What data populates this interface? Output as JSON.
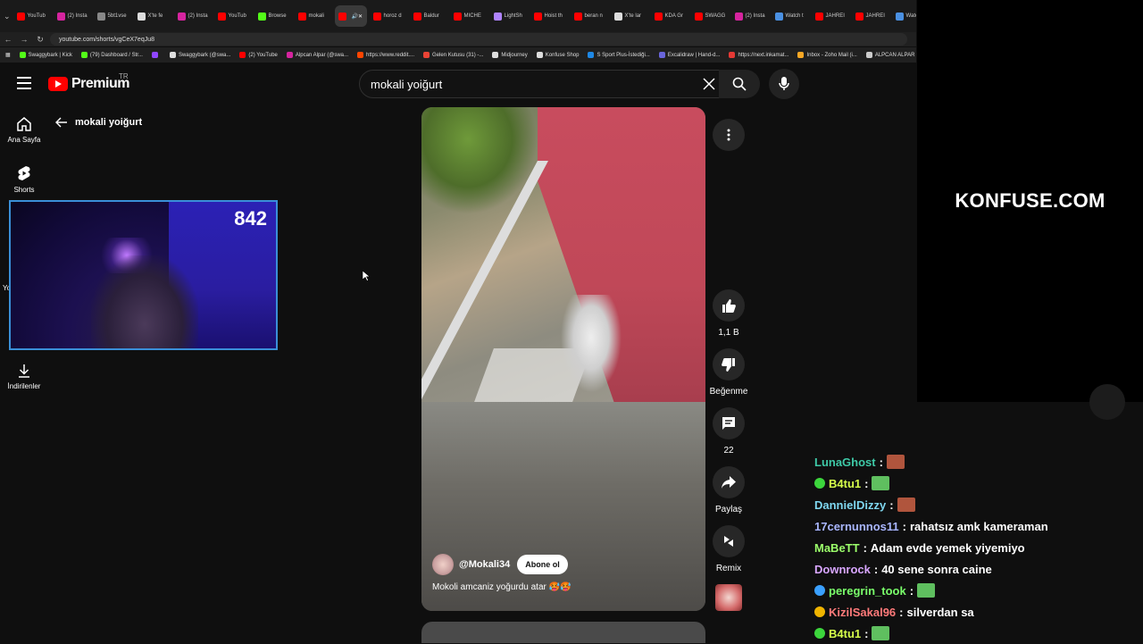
{
  "browser": {
    "tabs": [
      {
        "label": "YouTub",
        "color": "#ff0000"
      },
      {
        "label": "(2) Insta",
        "color": "#d6249f"
      },
      {
        "label": "5bt1vse",
        "color": "#888888"
      },
      {
        "label": "X'te fe",
        "color": "#dddddd"
      },
      {
        "label": "(2) Insta",
        "color": "#d6249f"
      },
      {
        "label": "YouTub",
        "color": "#ff0000"
      },
      {
        "label": "Browse",
        "color": "#53fc18"
      },
      {
        "label": "mokali",
        "color": "#ff0000"
      },
      {
        "label": "",
        "color": "#ff0000",
        "active": true
      },
      {
        "label": "horoz d",
        "color": "#ff0000"
      },
      {
        "label": "Baldur",
        "color": "#ff0000"
      },
      {
        "label": "MICHE",
        "color": "#ff0000"
      },
      {
        "label": "LightSh",
        "color": "#b084ff"
      },
      {
        "label": "Hoist th",
        "color": "#ff0000"
      },
      {
        "label": "beran n",
        "color": "#ff0000"
      },
      {
        "label": "X'te lar",
        "color": "#dddddd"
      },
      {
        "label": "KDA Gr",
        "color": "#ff0000"
      },
      {
        "label": "SWAGG",
        "color": "#ff0000"
      },
      {
        "label": "(2) Insta",
        "color": "#d6249f"
      },
      {
        "label": "Watch t",
        "color": "#4a90e2"
      },
      {
        "label": "JAHREI",
        "color": "#ff0000"
      },
      {
        "label": "JAHREI",
        "color": "#ff0000"
      },
      {
        "label": "Watch",
        "color": "#4a90e2"
      }
    ],
    "url": "youtube.com/shorts/vgCeX7eqJu8",
    "bookmarks": [
      {
        "label": "Swaggybark | Kick",
        "color": "#53fc18"
      },
      {
        "label": "(79) Dashboard / Str...",
        "color": "#53fc18"
      },
      {
        "label": "",
        "color": "#9146ff"
      },
      {
        "label": "Swaggybark (@swa...",
        "color": "#dddddd"
      },
      {
        "label": "(2) YouTube",
        "color": "#ff0000"
      },
      {
        "label": "Alpcan Alpar (@swa...",
        "color": "#d6249f"
      },
      {
        "label": "https://www.reddit....",
        "color": "#ff4500"
      },
      {
        "label": "Gelen Kutusu (31) -...",
        "color": "#ea4335"
      },
      {
        "label": "Midjourney",
        "color": "#dddddd"
      },
      {
        "label": "Konfuse Shop",
        "color": "#dddddd"
      },
      {
        "label": "S Sport Plus-İstediği...",
        "color": "#1e88e5"
      },
      {
        "label": "Excalidraw | Hand-d...",
        "color": "#6965db"
      },
      {
        "label": "https://next.inkamat...",
        "color": "#e53935"
      },
      {
        "label": "Inbox - Zoho Mail (i...",
        "color": "#f9a825"
      },
      {
        "label": "ALPCAN ALPAR DEV...",
        "color": "#cccccc"
      }
    ]
  },
  "header": {
    "logo": "Premium",
    "region": "TR",
    "search_value": "mokali yoiğurt"
  },
  "sidebar": {
    "items": [
      {
        "label": "Ana Sayfa",
        "icon": "home-icon"
      },
      {
        "label": "Shorts",
        "icon": "shorts-icon"
      },
      {
        "label": "Yo",
        "icon": "you-icon"
      },
      {
        "label": "İndirilenler",
        "icon": "download-icon"
      }
    ],
    "back_title": "mokali yoiğurt"
  },
  "webcam": {
    "counter": "842"
  },
  "short": {
    "channel": "@Mokali34",
    "subscribe": "Abone ol",
    "caption": "Mokoli amcaniz yoğurdu atar 🥵🥵"
  },
  "actions": {
    "like_count": "1,1 B",
    "dislike_label": "Beğenme",
    "comment_count": "22",
    "share_label": "Paylaş",
    "remix_label": "Remix"
  },
  "overlay": {
    "brand": "KONFUSE.COM"
  },
  "chat": [
    {
      "user": "LunaGhost",
      "color": "#3ec9a7",
      "text": "",
      "emote": "#b0553d"
    },
    {
      "user": "B4tu1",
      "color": "#d6ff4a",
      "text": "",
      "emote": "#5fbf5f",
      "badge": "#3cd63c"
    },
    {
      "user": "DannielDizzy",
      "color": "#7fd7f0",
      "text": "",
      "emote": "#b0553d"
    },
    {
      "user": "17cernunnos11",
      "color": "#a9b6ff",
      "text": "rahatsız amk kameraman"
    },
    {
      "user": "MaBeTT",
      "color": "#9cff6b",
      "text": "Adam evde yemek yiyemiyo"
    },
    {
      "user": "Downrock",
      "color": "#d8a6ff",
      "text": "40 sene sonra caine"
    },
    {
      "user": "peregrin_took",
      "color": "#7aff6b",
      "text": "",
      "emote": "#5fbf5f",
      "badge": "#3aa0ff"
    },
    {
      "user": "KizilSakal96",
      "color": "#ff7a7a",
      "text": "silverdan sa",
      "badge": "#f0b400"
    },
    {
      "user": "B4tu1",
      "color": "#d6ff4a",
      "text": "",
      "emote": "#5fbf5f",
      "badge": "#3cd63c"
    }
  ]
}
